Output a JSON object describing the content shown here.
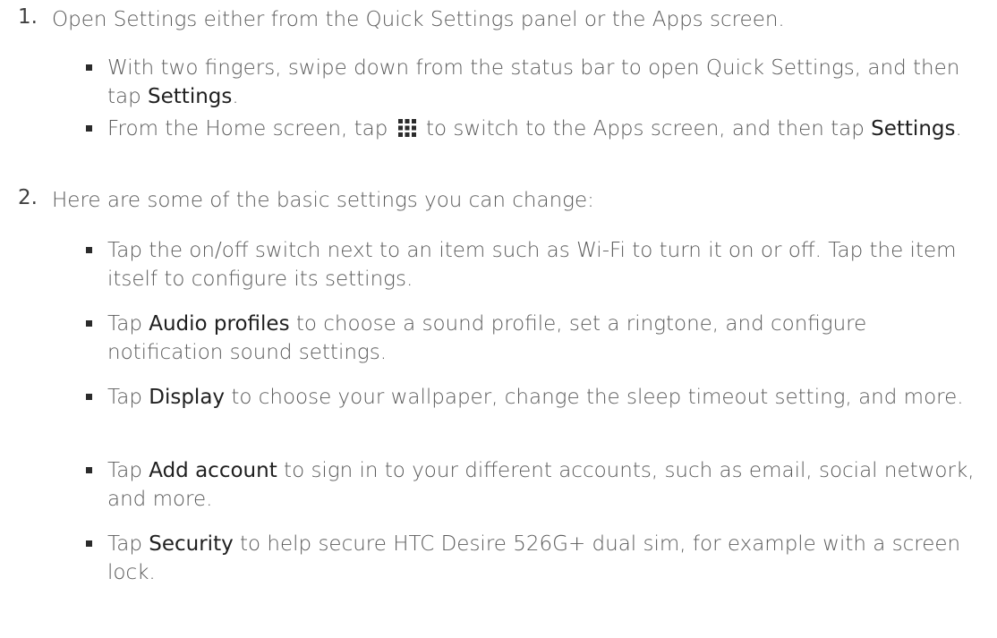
{
  "steps": [
    {
      "number": "1.",
      "text": "Open Settings either from the Quick Settings panel or the Apps screen.",
      "bullets": [
        {
          "pre": "With two fingers, swipe down from the status bar to open Quick Settings, and then tap ",
          "term": "Settings",
          "post": "."
        },
        {
          "pre": "From the Home screen, tap ",
          "icon": "apps-grid-icon",
          "mid": " to switch to the Apps screen, and then tap ",
          "term": "Settings",
          "post": "."
        }
      ]
    },
    {
      "number": "2.",
      "text": "Here are some of the basic settings you can change:",
      "bullets": [
        {
          "pre": "Tap the on/off switch next to an item such as Wi-Fi to turn it on or off. Tap the item itself to configure its settings."
        },
        {
          "pre": "Tap ",
          "term": "Audio profiles",
          "post": " to choose a sound profile, set a ringtone, and configure notification sound settings."
        },
        {
          "pre": "Tap ",
          "term": "Display",
          "post": " to choose your wallpaper, change the sleep timeout setting, and more."
        },
        {
          "pre": "Tap ",
          "term": "Add account",
          "post": " to sign in to your different accounts, such as email, social network, and more."
        },
        {
          "pre": "Tap ",
          "term": "Security",
          "post": " to help secure HTC Desire 526G+ dual sim, for example with a screen lock."
        }
      ]
    }
  ]
}
